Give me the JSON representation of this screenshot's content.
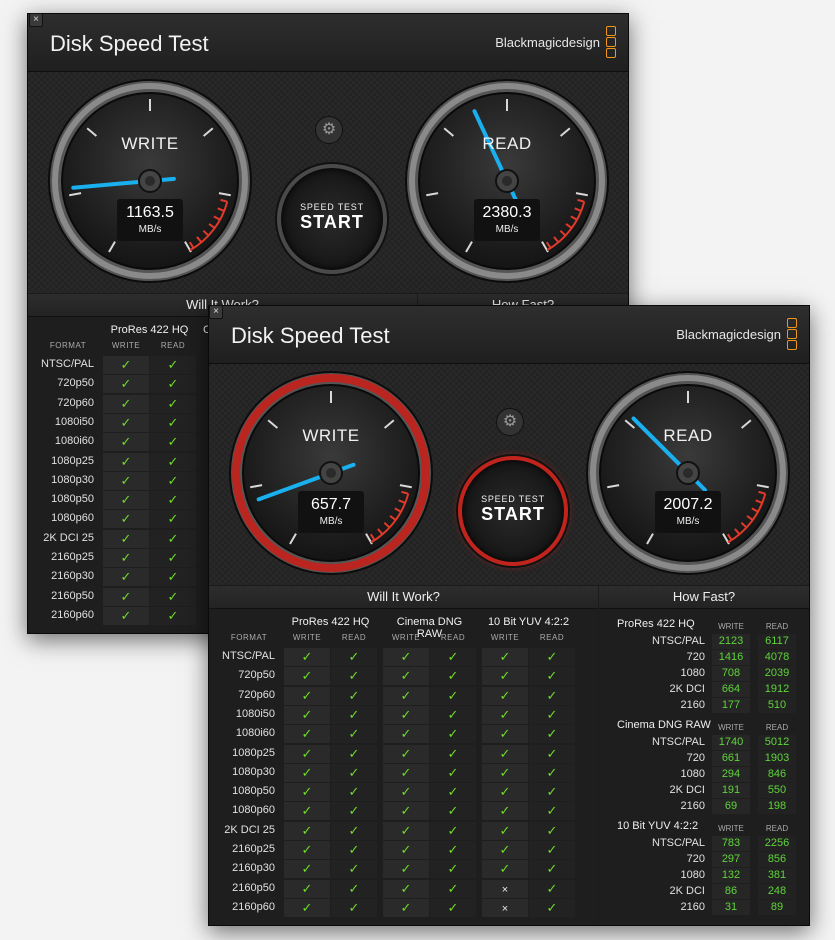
{
  "windows": [
    {
      "id": "back",
      "title": "Disk Speed Test",
      "brand": "Blackmagicdesign",
      "close": "×",
      "write": {
        "label": "WRITE",
        "value": "1163.5",
        "unit": "MB/s",
        "needle_angle": -95
      },
      "read": {
        "label": "READ",
        "value": "2380.3",
        "unit": "MB/s",
        "needle_angle": -25
      },
      "start": {
        "line1": "SPEED TEST",
        "line2": "START",
        "active": false
      },
      "will_it_work": "Will It Work?",
      "how_fast": "How Fast?"
    },
    {
      "id": "front",
      "title": "Disk Speed Test",
      "brand": "Blackmagicdesign",
      "close": "×",
      "write": {
        "label": "WRITE",
        "value": "657.7",
        "unit": "MB/s",
        "needle_angle": -110
      },
      "read": {
        "label": "READ",
        "value": "2007.2",
        "unit": "MB/s",
        "needle_angle": -45
      },
      "start": {
        "line1": "SPEED TEST",
        "line2": "START",
        "active": true
      },
      "will_it_work": "Will It Work?",
      "how_fast": "How Fast?"
    }
  ],
  "format_label": "FORMAT",
  "write_label": "WRITE",
  "read_label": "READ",
  "codecs": [
    "ProRes 422 HQ",
    "Cinema DNG RAW",
    "10 Bit YUV 4:2:2"
  ],
  "back_codec_partial": "C",
  "formats": [
    "NTSC/PAL",
    "720p50",
    "720p60",
    "1080i50",
    "1080i60",
    "1080p25",
    "1080p30",
    "1080p50",
    "1080p60",
    "2K DCI 25",
    "2160p25",
    "2160p30",
    "2160p50",
    "2160p60"
  ],
  "check_mark": "✓",
  "cross_mark": "×",
  "front_support": [
    [
      1,
      1,
      1,
      1,
      1,
      1
    ],
    [
      1,
      1,
      1,
      1,
      1,
      1
    ],
    [
      1,
      1,
      1,
      1,
      1,
      1
    ],
    [
      1,
      1,
      1,
      1,
      1,
      1
    ],
    [
      1,
      1,
      1,
      1,
      1,
      1
    ],
    [
      1,
      1,
      1,
      1,
      1,
      1
    ],
    [
      1,
      1,
      1,
      1,
      1,
      1
    ],
    [
      1,
      1,
      1,
      1,
      1,
      1
    ],
    [
      1,
      1,
      1,
      1,
      1,
      1
    ],
    [
      1,
      1,
      1,
      1,
      1,
      1
    ],
    [
      1,
      1,
      1,
      1,
      1,
      1
    ],
    [
      1,
      1,
      1,
      1,
      1,
      1
    ],
    [
      1,
      1,
      1,
      1,
      0,
      1
    ],
    [
      1,
      1,
      1,
      1,
      0,
      1
    ]
  ],
  "how_fast": [
    {
      "codec": "ProRes 422 HQ",
      "rows": [
        {
          "fmt": "NTSC/PAL",
          "write": "2123",
          "read": "6117"
        },
        {
          "fmt": "720",
          "write": "1416",
          "read": "4078"
        },
        {
          "fmt": "1080",
          "write": "708",
          "read": "2039"
        },
        {
          "fmt": "2K DCI",
          "write": "664",
          "read": "1912"
        },
        {
          "fmt": "2160",
          "write": "177",
          "read": "510"
        }
      ]
    },
    {
      "codec": "Cinema DNG RAW",
      "rows": [
        {
          "fmt": "NTSC/PAL",
          "write": "1740",
          "read": "5012"
        },
        {
          "fmt": "720",
          "write": "661",
          "read": "1903"
        },
        {
          "fmt": "1080",
          "write": "294",
          "read": "846"
        },
        {
          "fmt": "2K DCI",
          "write": "191",
          "read": "550"
        },
        {
          "fmt": "2160",
          "write": "69",
          "read": "198"
        }
      ]
    },
    {
      "codec": "10 Bit YUV 4:2:2",
      "rows": [
        {
          "fmt": "NTSC/PAL",
          "write": "783",
          "read": "2256"
        },
        {
          "fmt": "720",
          "write": "297",
          "read": "856"
        },
        {
          "fmt": "1080",
          "write": "132",
          "read": "381"
        },
        {
          "fmt": "2K DCI",
          "write": "86",
          "read": "248"
        },
        {
          "fmt": "2160",
          "write": "31",
          "read": "89"
        }
      ]
    }
  ],
  "colors": {
    "accent_orange": "#f0961e",
    "needle_blue": "#1ab0f0",
    "check_green": "#6fdc2a",
    "value_green": "#5fd43a",
    "active_red": "#c0241c"
  }
}
